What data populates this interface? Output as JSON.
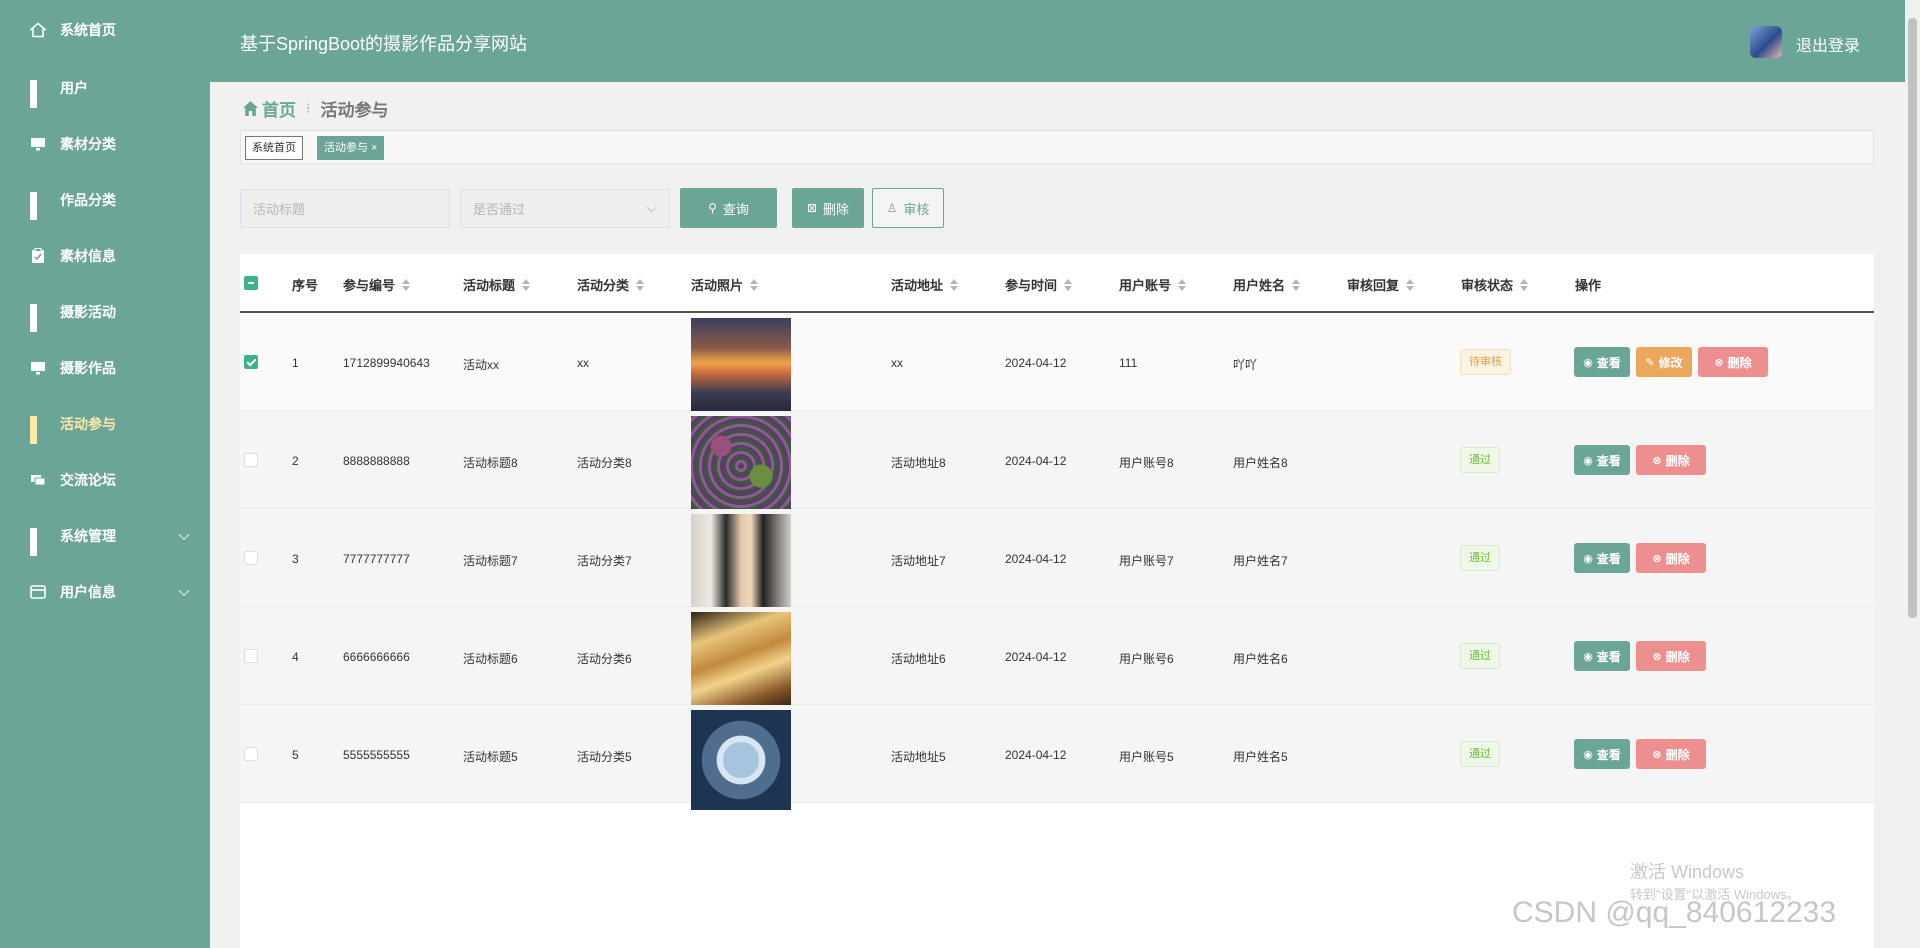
{
  "header": {
    "title": "基于SpringBoot的摄影作品分享网站",
    "logout_label": "退出登录"
  },
  "sidebar": {
    "items": [
      {
        "label": "系统首页",
        "icon": "home-icon"
      },
      {
        "label": "用户",
        "icon": "grid-icon"
      },
      {
        "label": "素材分类",
        "icon": "monitor-icon"
      },
      {
        "label": "作品分类",
        "icon": "grid-icon"
      },
      {
        "label": "素材信息",
        "icon": "clipboard-icon"
      },
      {
        "label": "摄影活动",
        "icon": "grid-icon"
      },
      {
        "label": "摄影作品",
        "icon": "monitor-icon"
      },
      {
        "label": "活动参与",
        "icon": "grid-icon",
        "active": true
      },
      {
        "label": "交流论坛",
        "icon": "chat-icon"
      },
      {
        "label": "系统管理",
        "icon": "grid-icon",
        "expandable": true
      },
      {
        "label": "用户信息",
        "icon": "card-icon",
        "expandable": true
      }
    ]
  },
  "breadcrumb": {
    "home": "首页",
    "current": "活动参与"
  },
  "tags": [
    {
      "label": "系统首页"
    },
    {
      "label": "活动参与 ×"
    }
  ],
  "filters": {
    "title_placeholder": "活动标题",
    "status_placeholder": "是否通过",
    "query_label": "查询",
    "delete_label": "删除",
    "audit_label": "审核"
  },
  "table": {
    "columns": [
      "序号",
      "参与编号",
      "活动标题",
      "活动分类",
      "活动照片",
      "活动地址",
      "参与时间",
      "用户账号",
      "用户姓名",
      "审核回复",
      "审核状态",
      "操作"
    ],
    "actions": {
      "view": "查看",
      "edit": "修改",
      "delete": "删除"
    },
    "rows": [
      {
        "index": "1",
        "number": "1712899940643",
        "title": "活动xx",
        "category": "xx",
        "address": "xx",
        "time": "2024-04-12",
        "account": "111",
        "name": "吖吖",
        "reply": "",
        "status": "待审核",
        "status_type": "pending",
        "checked": true,
        "editable": true
      },
      {
        "index": "2",
        "number": "8888888888",
        "title": "活动标题8",
        "category": "活动分类8",
        "address": "活动地址8",
        "time": "2024-04-12",
        "account": "用户账号8",
        "name": "用户姓名8",
        "reply": "",
        "status": "通过",
        "status_type": "pass",
        "checked": false,
        "editable": false
      },
      {
        "index": "3",
        "number": "7777777777",
        "title": "活动标题7",
        "category": "活动分类7",
        "address": "活动地址7",
        "time": "2024-04-12",
        "account": "用户账号7",
        "name": "用户姓名7",
        "reply": "",
        "status": "通过",
        "status_type": "pass",
        "checked": false,
        "editable": false
      },
      {
        "index": "4",
        "number": "6666666666",
        "title": "活动标题6",
        "category": "活动分类6",
        "address": "活动地址6",
        "time": "2024-04-12",
        "account": "用户账号6",
        "name": "用户姓名6",
        "reply": "",
        "status": "通过",
        "status_type": "pass",
        "checked": false,
        "editable": false
      },
      {
        "index": "5",
        "number": "5555555555",
        "title": "活动标题5",
        "category": "活动分类5",
        "address": "活动地址5",
        "time": "2024-04-12",
        "account": "用户账号5",
        "name": "用户姓名5",
        "reply": "",
        "status": "通过",
        "status_type": "pass",
        "checked": false,
        "editable": false
      }
    ]
  },
  "overlay": {
    "activate_title": "激活 Windows",
    "activate_sub": "转到\"设置\"以激活 Windows。",
    "csdn": "CSDN @qq_840612233"
  },
  "colors": {
    "primary": "#6ba597",
    "active_nav": "#ffe9a8",
    "edit": "#eba85c",
    "danger": "#ee8f8f",
    "checkbox": "#3fb28b"
  }
}
